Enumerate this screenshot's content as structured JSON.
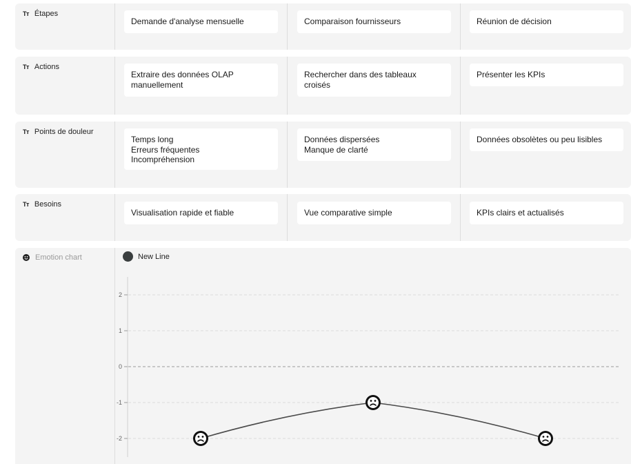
{
  "rows": [
    {
      "label": "Étapes",
      "cells": [
        "Demande d'analyse mensuelle",
        "Comparaison fournisseurs",
        "Réunion de décision"
      ]
    },
    {
      "label": "Actions",
      "cells": [
        "Extraire des données OLAP\nmanuellement",
        "Rechercher dans des tableaux\ncroisés",
        "Présenter les KPIs"
      ]
    },
    {
      "label": "Points de douleur",
      "cells": [
        "Temps long\nErreurs fréquentes\nIncompréhension",
        "Données dispersées\nManque de clarté",
        "Données obsolètes ou peu lisibles"
      ]
    },
    {
      "label": "Besoins",
      "cells": [
        "Visualisation rapide et fiable",
        "Vue comparative simple",
        "KPIs clairs et actualisés"
      ]
    }
  ],
  "row_icon": "text-type-icon",
  "emotion": {
    "label": "Emotion chart",
    "icon": "smile-icon"
  },
  "chart_data": {
    "type": "line",
    "series": [
      {
        "name": "New Line",
        "color": "#3a3e3f",
        "values": [
          -2,
          -1,
          -2
        ],
        "markers": [
          "sad-face-icon",
          "sad-face-icon",
          "sad-face-icon"
        ]
      }
    ],
    "ylim": [
      -2,
      2
    ],
    "yticks": [
      "2",
      "1",
      "0",
      "-1",
      "-2"
    ],
    "grid": true,
    "legend": "top-left"
  }
}
